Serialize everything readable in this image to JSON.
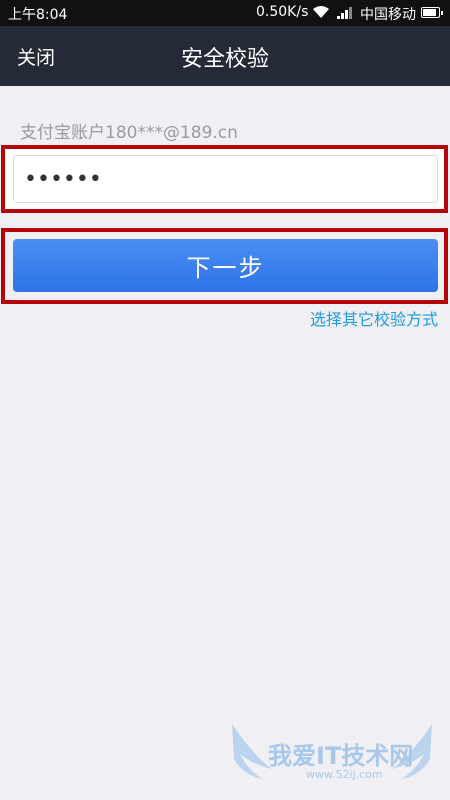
{
  "status_bar": {
    "time": "上午8:04",
    "speed": "0.50K/s",
    "carrier": "中国移动",
    "battery_level": 0.85
  },
  "nav": {
    "close_label": "关闭",
    "title": "安全校验"
  },
  "form": {
    "account_label": "支付宝账户180***@189.cn",
    "password_value": "••••••",
    "next_label": "下一步",
    "alt_link": "选择其它校验方式"
  },
  "watermark": {
    "text": "我爱IT技术网",
    "sub": "www.52ij.com"
  },
  "colors": {
    "nav_bg": "#252a38",
    "button_blue": "#3a7ff0",
    "highlight_red": "#b5050b",
    "link_blue": "#1e9be2"
  }
}
